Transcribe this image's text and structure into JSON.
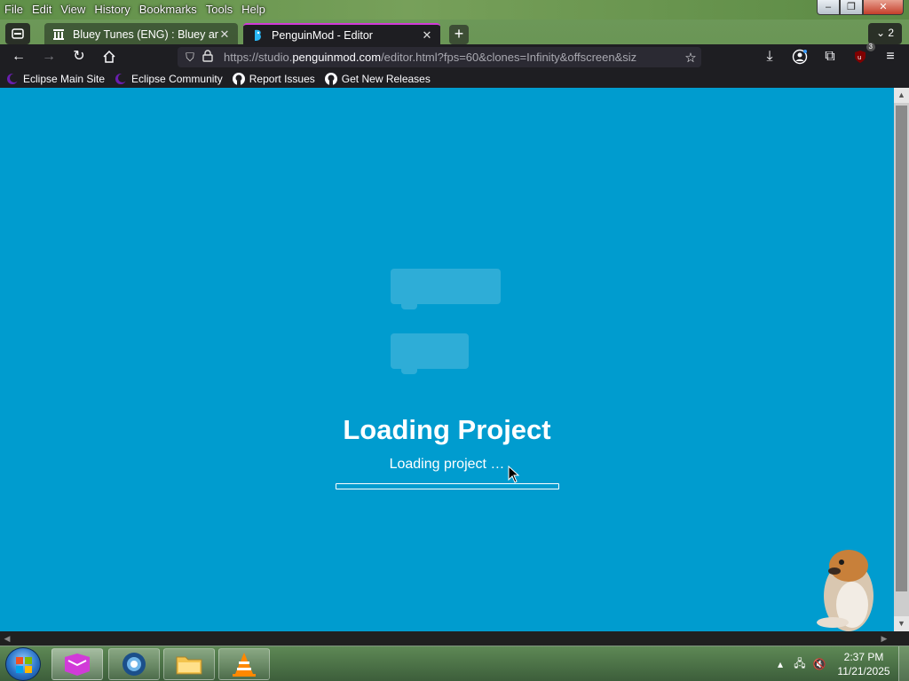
{
  "menubar": {
    "items": [
      "File",
      "Edit",
      "View",
      "History",
      "Bookmarks",
      "Tools",
      "Help"
    ]
  },
  "window_controls": {
    "minimize": "–",
    "restore": "❐",
    "close": "✕"
  },
  "tabs": [
    {
      "title": "Bluey Tunes (ENG) : Bluey and A",
      "icon": "archive-icon",
      "active": false
    },
    {
      "title": "PenguinMod - Editor",
      "icon": "penguinmod-icon",
      "active": true
    }
  ],
  "tab_list": {
    "count": "2"
  },
  "navbar": {
    "url_prefix": "https://studio.",
    "url_host": "penguinmod.com",
    "url_rest": "/editor.html?fps=60&clones=Infinity&offscreen&siz",
    "extension_badge": "3"
  },
  "bookmarks": [
    {
      "label": "Eclipse Main Site",
      "icon": "eclipse-icon"
    },
    {
      "label": "Eclipse Community",
      "icon": "eclipse-icon"
    },
    {
      "label": "Report Issues",
      "icon": "github-icon"
    },
    {
      "label": "Get New Releases",
      "icon": "github-icon"
    }
  ],
  "loader": {
    "title": "Loading Project",
    "status": "Loading project …",
    "progress": 0
  },
  "colors": {
    "stage_bg": "#009ccf",
    "browser_chrome": "#1e1e22",
    "active_tab_accent": "#d13bd8"
  },
  "taskbar": {
    "time": "2:37 PM",
    "date": "11/21/2025"
  }
}
